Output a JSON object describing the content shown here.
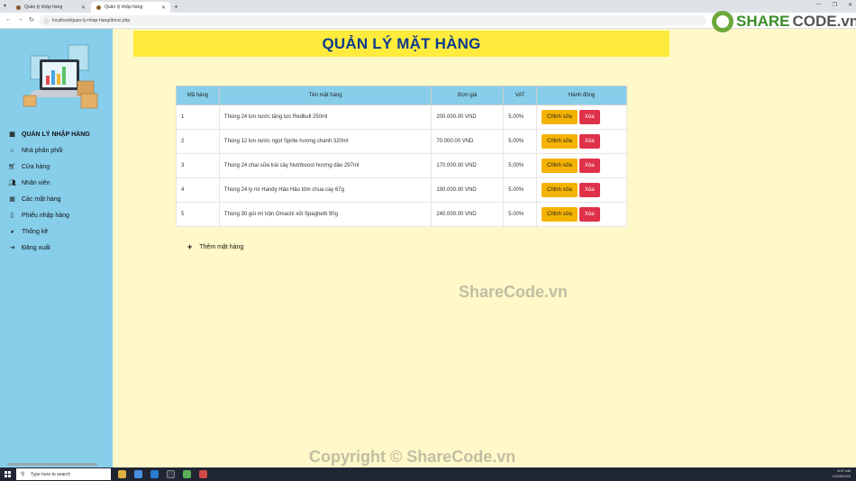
{
  "browser": {
    "tabs": [
      {
        "label": "Quản lý nhập hàng"
      },
      {
        "label": "Quản lý nhập hàng"
      }
    ],
    "url": "localhost/quan-ly-nhap-hang/donvi.php"
  },
  "sidebar": {
    "items": [
      {
        "icon": "grid-icon",
        "label": "QUẢN LÝ NHẬP HÀNG"
      },
      {
        "icon": "home-icon",
        "label": "Nhà phân phối"
      },
      {
        "icon": "cart-icon",
        "label": "Cửa hàng"
      },
      {
        "icon": "users-icon",
        "label": "Nhân viên"
      },
      {
        "icon": "grid-icon",
        "label": "Các mặt hàng"
      },
      {
        "icon": "file-icon",
        "label": "Phiếu nhập hàng"
      },
      {
        "icon": "pie-chart-icon",
        "label": "Thống kê"
      },
      {
        "icon": "logout-icon",
        "label": "Đăng xuất"
      }
    ]
  },
  "page": {
    "title": "QUẢN LÝ MẶT HÀNG",
    "add_label": "Thêm mặt hàng"
  },
  "table": {
    "headers": [
      "Mã hàng",
      "Tên mặt hàng",
      "Đơn giá",
      "VAT",
      "Hành động"
    ],
    "rows": [
      {
        "id": "1",
        "name": "Thùng 24 lon nước tăng lực Redbull 250ml",
        "price": "200.000.00 VND",
        "vat": "5.00%"
      },
      {
        "id": "2",
        "name": "Thùng 12 lon nước ngọt Sprite hương chanh 320ml",
        "price": "70.000.00 VND",
        "vat": "5.00%"
      },
      {
        "id": "3",
        "name": "Thùng 24 chai sữa trái cây Nutriboost hương dâu 297ml",
        "price": "170.000.00 VND",
        "vat": "5.00%"
      },
      {
        "id": "4",
        "name": "Thùng 24 ly mì Handy Hảo Hảo tôm chua cay 67g",
        "price": "190.000.00 VND",
        "vat": "5.00%"
      },
      {
        "id": "5",
        "name": "Thùng 30 gói mì trộn Omachi xốt Spaghetti 90g",
        "price": "240.000.00 VND",
        "vat": "5.00%"
      }
    ],
    "edit_label": "Chỉnh sửa",
    "delete_label": "Xóa"
  },
  "watermarks": {
    "center": "ShareCode.vn",
    "bottom": "Copyright © ShareCode.vn",
    "brand_a": "SHARE",
    "brand_b": "CODE.vn"
  },
  "taskbar": {
    "search_placeholder": "Type here to search",
    "time": "8:37 AM",
    "date": "01/05/2025"
  },
  "colors": {
    "sidebar": "#87ceeb",
    "main_bg": "#fff8c8",
    "header_bg": "#ffeb3b",
    "title": "#0d3b8c",
    "edit_button": "#f5b301",
    "delete_button": "#e0314b"
  }
}
